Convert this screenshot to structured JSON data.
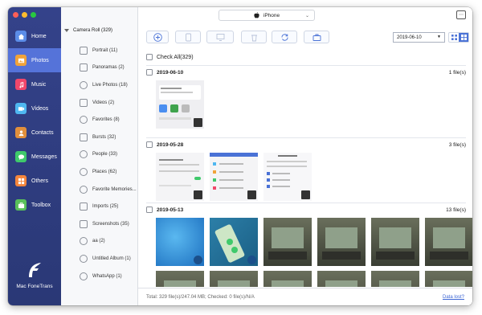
{
  "app": {
    "name": "Mac FoneTrans"
  },
  "device": {
    "name": "iPhone"
  },
  "nav": {
    "items": [
      {
        "label": "Home",
        "icon": "home-icon",
        "color": "#5b8de8"
      },
      {
        "label": "Photos",
        "icon": "photos-icon",
        "color": "#f0a33a",
        "active": true
      },
      {
        "label": "Music",
        "icon": "music-icon",
        "color": "#f0476b"
      },
      {
        "label": "Videos",
        "icon": "videos-icon",
        "color": "#4fb7f0"
      },
      {
        "label": "Contacts",
        "icon": "contacts-icon",
        "color": "#e08f3c"
      },
      {
        "label": "Messages",
        "icon": "messages-icon",
        "color": "#3fc96b"
      },
      {
        "label": "Others",
        "icon": "others-icon",
        "color": "#f5863c"
      },
      {
        "label": "Toolbox",
        "icon": "toolbox-icon",
        "color": "#59c05a"
      }
    ]
  },
  "albums": {
    "header": "Camera Roll (329)",
    "items": [
      {
        "label": "Portrait (11)"
      },
      {
        "label": "Panoramas (2)"
      },
      {
        "label": "Live Photos (18)"
      },
      {
        "label": "Videos (2)"
      },
      {
        "label": "Favorites (8)"
      },
      {
        "label": "Bursts (32)"
      },
      {
        "label": "People (33)"
      },
      {
        "label": "Places (62)"
      },
      {
        "label": "Favorite Memories..."
      },
      {
        "label": "Imports (25)"
      },
      {
        "label": "Screenshots (35)"
      },
      {
        "label": "aa (2)"
      },
      {
        "label": "Untitled Album (1)"
      },
      {
        "label": "WhatsApp (1)"
      }
    ]
  },
  "toolbar": {
    "date_value": "2019-06-10",
    "accent": "#4a72d6"
  },
  "content": {
    "check_all": "Check All(329)",
    "groups": [
      {
        "date": "2019-06-10",
        "count": "1 file(s)"
      },
      {
        "date": "2019-05-28",
        "count": "3 file(s)"
      },
      {
        "date": "2019-05-13",
        "count": "13 file(s)"
      }
    ]
  },
  "status": {
    "text": "Total: 329 file(s)/247.04 MB; Checked: 0 file(s)/N/A",
    "link": "Data lost?"
  }
}
